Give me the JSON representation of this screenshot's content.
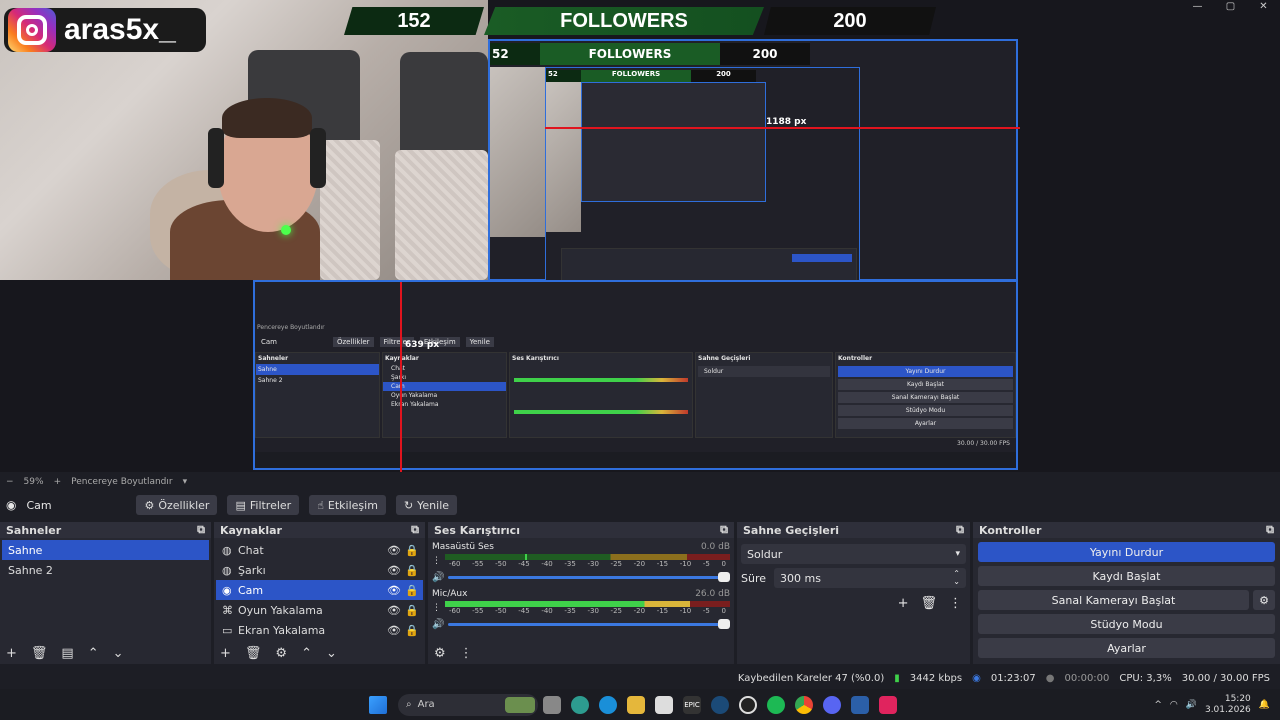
{
  "window": {
    "minimize": "—",
    "maximize": "▢",
    "close": "✕"
  },
  "overlay": {
    "instagram_handle": "aras5x_",
    "followers_current": "152",
    "followers_label": "FOLLOWERS",
    "followers_goal": "200"
  },
  "nested_preview": {
    "followers_current": "52",
    "followers_label": "FOLLOWERS",
    "followers_goal": "200",
    "measure_h": "1188 px",
    "measure_v": "639 px",
    "mini_followers_label": "FOLLOWERS",
    "mini_goal": "200",
    "mini_current": "52"
  },
  "zoom": {
    "minus": "−",
    "value": "59%",
    "plus": "+",
    "mode": "Pencereye Boyutlandır"
  },
  "source_toolbar": {
    "source_name": "Cam",
    "properties": "Özellikler",
    "filters": "Filtreler",
    "interact": "Etkileşim",
    "refresh": "Yenile"
  },
  "scenes": {
    "title": "Sahneler",
    "items": [
      {
        "label": "Sahne"
      },
      {
        "label": "Sahne 2"
      }
    ]
  },
  "sources": {
    "title": "Kaynaklar",
    "items": [
      {
        "label": "Chat"
      },
      {
        "label": "Şarkı"
      },
      {
        "label": "Cam"
      },
      {
        "label": "Oyun Yakalama"
      },
      {
        "label": "Ekran Yakalama"
      }
    ]
  },
  "mixer": {
    "title": "Ses Karıştırıcı",
    "channels": [
      {
        "name": "Masaüstü Ses",
        "db": "0.0 dB",
        "level": 0.3
      },
      {
        "name": "Mic/Aux",
        "db": "26.0 dB",
        "level": 0.85
      }
    ],
    "ticks": [
      "-60",
      "-55",
      "-50",
      "-45",
      "-40",
      "-35",
      "-30",
      "-25",
      "-20",
      "-15",
      "-10",
      "-5",
      "0"
    ]
  },
  "transitions": {
    "title": "Sahne Geçişleri",
    "selected": "Soldur",
    "duration_label": "Süre",
    "duration_value": "300 ms"
  },
  "controls": {
    "title": "Kontroller",
    "stop_stream": "Yayını Durdur",
    "start_record": "Kaydı Başlat",
    "virtual_cam": "Sanal Kamerayı Başlat",
    "studio_mode": "Stüdyo Modu",
    "settings": "Ayarlar"
  },
  "status": {
    "dropped": "Kaybedilen Kareler 47 (%0.0)",
    "bitrate": "3442 kbps",
    "stream_time": "01:23:07",
    "record_time": "00:00:00",
    "cpu": "CPU: 3,3%",
    "fps": "30.00 / 30.00 FPS"
  },
  "taskbar": {
    "search": "Ara",
    "time": "15:20",
    "date": "3.01.2026",
    "tray_caret": "^"
  },
  "colors": {
    "accent": "#2c55c7",
    "meter_green": "#3fd14a",
    "meter_yellow": "#d9b53a",
    "meter_red": "#c0392b",
    "measure_red": "#e0141e"
  }
}
